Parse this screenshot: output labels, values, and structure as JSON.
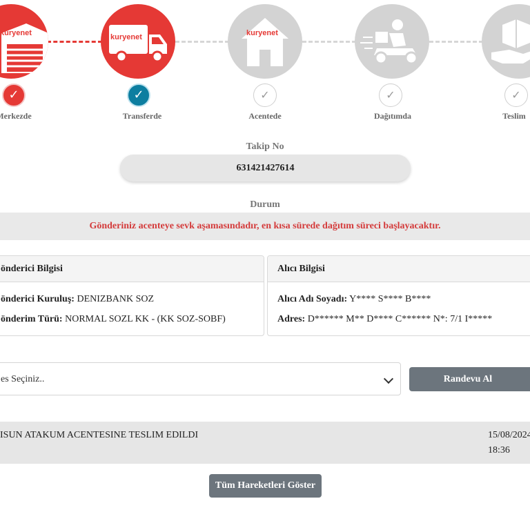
{
  "tracker": {
    "brand": "kuryenet",
    "steps": [
      {
        "label": "Merkezde",
        "check": "✓",
        "status": "done"
      },
      {
        "label": "Transferde",
        "check": "✓",
        "status": "current"
      },
      {
        "label": "Acentede",
        "check": "✓",
        "status": "pending"
      },
      {
        "label": "Dağıtımda",
        "check": "✓",
        "status": "pending"
      },
      {
        "label": "Teslim",
        "check": "✓",
        "status": "pending"
      }
    ],
    "colors": {
      "active": "#e53935",
      "current_check": "#0d7ea0",
      "inactive": "#d3d3d3"
    }
  },
  "takip": {
    "label": "Takip No",
    "value": "631421427614"
  },
  "durum": {
    "label": "Durum",
    "message": "Gönderiniz acenteye sevk aşamasındadır, en kısa sürede dağıtım süreci başlayacaktır."
  },
  "sender": {
    "title": "önderici Bilgisi",
    "org_label": "önderici Kuruluş:",
    "org_value": " DENIZBANK SOZ",
    "type_label": "önderim Türü:",
    "type_value": " NORMAL SOZL KK - (KK SOZ-SOBF)"
  },
  "receiver": {
    "title": "Alıcı Bilgisi",
    "name_label": "Alıcı Adı Soyadı:",
    "name_value": " Y**** S**** B****",
    "addr_label": "Adres:",
    "addr_value": " D****** M** D**** C****** N*: 7/1 I*****"
  },
  "appointment": {
    "select_text": "es Seçiniz..",
    "button": "Randevu Al"
  },
  "movement": {
    "text": "ISUN ATAKUM ACENTESINE TESLIM EDILDI",
    "date": "15/08/2024",
    "time": "18:36"
  },
  "all_button": "Tüm Hareketleri Göster"
}
